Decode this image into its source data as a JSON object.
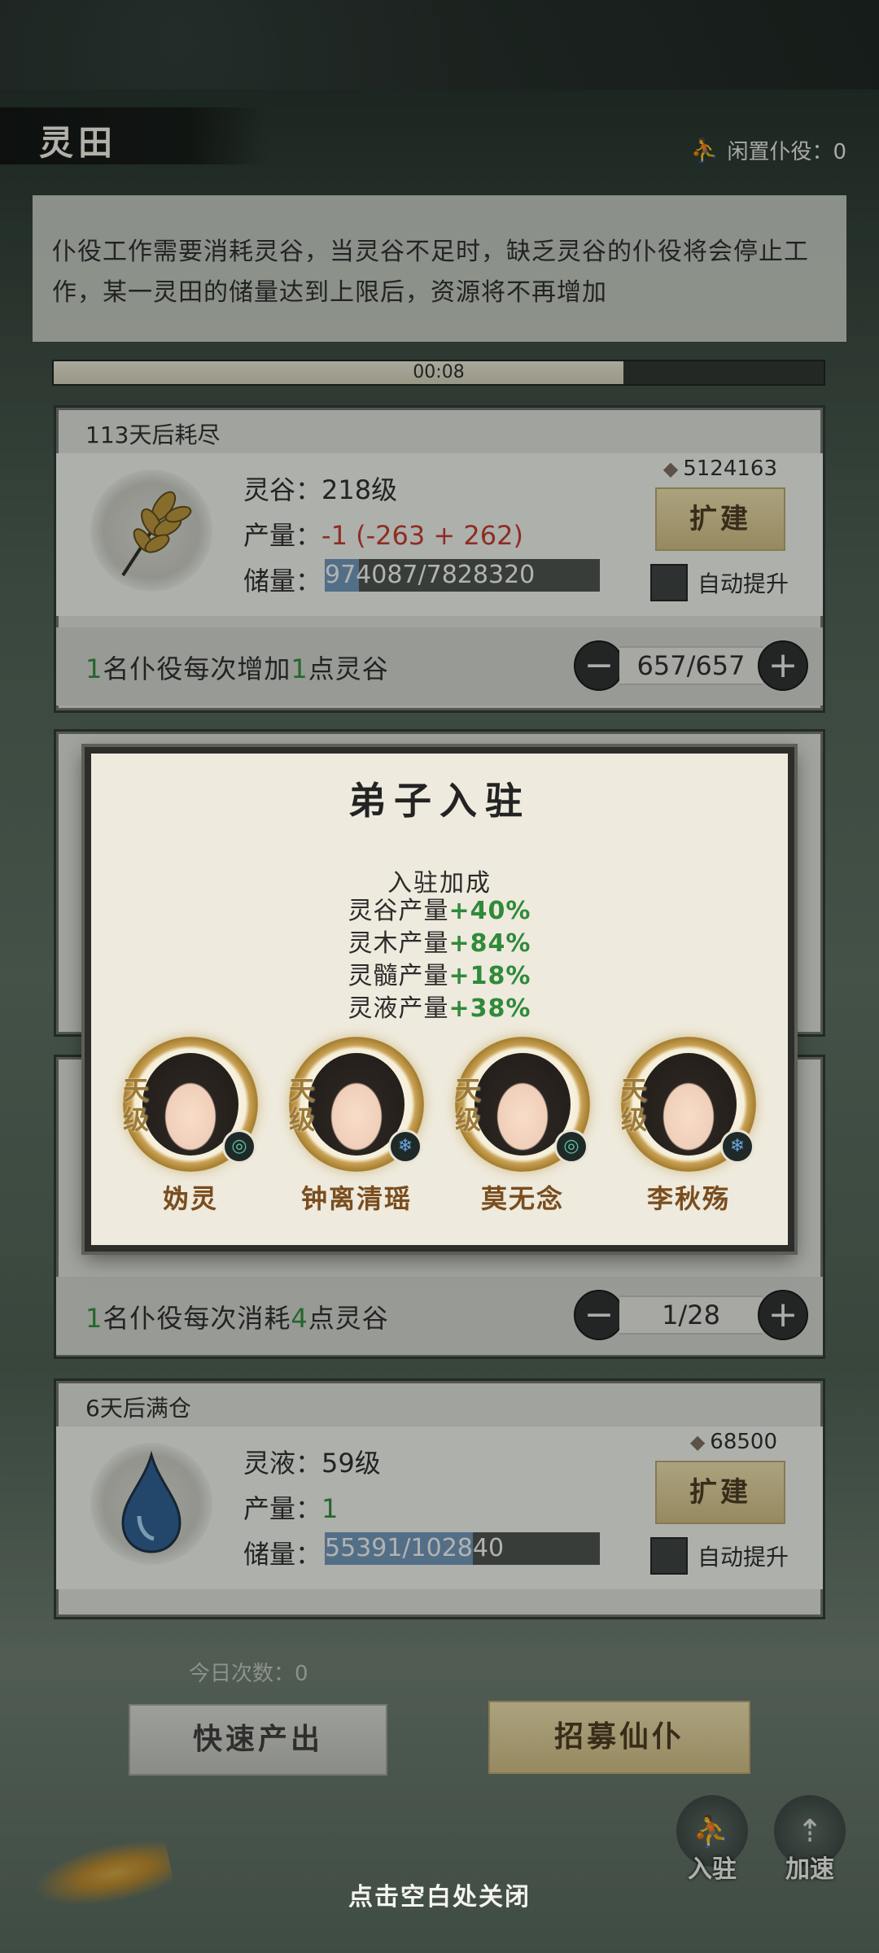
{
  "header": {
    "title": "灵田",
    "idle_servants_label": "闲置仆役：0"
  },
  "info": {
    "text": "仆役工作需要消耗灵谷，当灵谷不足时，缺乏灵谷的仆役将会停止工作，某一灵田的储量达到上限后，资源将不再增加",
    "timer": "00:08",
    "timer_progress": 0.74
  },
  "fields": [
    {
      "status": "113天后耗尽",
      "name_line": "灵谷：218级",
      "output_label": "产量：",
      "output_value": "-1 (-263 + 262)",
      "storage_label": "储量：",
      "storage_value": "974087/7828320",
      "storage_fill": 0.124,
      "capacity": "5124163",
      "expand_label": "扩建",
      "auto_label": "自动提升",
      "servant_pre": "1",
      "servant_mid": "名仆役每次增加",
      "servant_num": "1",
      "servant_post": "点灵谷",
      "stepper_value": "657/657"
    },
    {
      "servant_pre": "1",
      "servant_mid": "名仆役每次消耗",
      "servant_num": "4",
      "servant_post": "点灵谷",
      "stepper_value": "1/28"
    },
    {
      "status": "6天后满仓",
      "name_line": "灵液：59级",
      "output_label": "产量：",
      "output_value": "1",
      "storage_label": "储量：",
      "storage_value": "55391/102840",
      "storage_fill": 0.539,
      "capacity": "68500",
      "expand_label": "扩建",
      "auto_label": "自动提升"
    }
  ],
  "modal": {
    "title": "弟子入驻",
    "bonus_title": "入驻加成",
    "bonuses": [
      {
        "label": "灵谷产量",
        "pct": "+40%"
      },
      {
        "label": "灵木产量",
        "pct": "+84%"
      },
      {
        "label": "灵髓产量",
        "pct": "+18%"
      },
      {
        "label": "灵液产量",
        "pct": "+38%"
      }
    ],
    "disciples": [
      {
        "name": "妫灵",
        "grade": "天级",
        "element": "wind-icon"
      },
      {
        "name": "钟离清瑶",
        "grade": "天级",
        "element": "ice-icon"
      },
      {
        "name": "莫无念",
        "grade": "天级",
        "element": "wind-icon"
      },
      {
        "name": "李秋殇",
        "grade": "天级",
        "element": "ice-icon"
      }
    ]
  },
  "footer": {
    "daily_count": "今日次数：0",
    "quick_label": "快速产出",
    "recruit_label": "招募仙仆",
    "station_label": "入驻",
    "accelerate_label": "加速",
    "close_hint": "点击空白处关闭"
  },
  "colors": {
    "accent_green": "#2f8a3a",
    "accent_red": "#c0392b",
    "gold": "#c9a154"
  }
}
